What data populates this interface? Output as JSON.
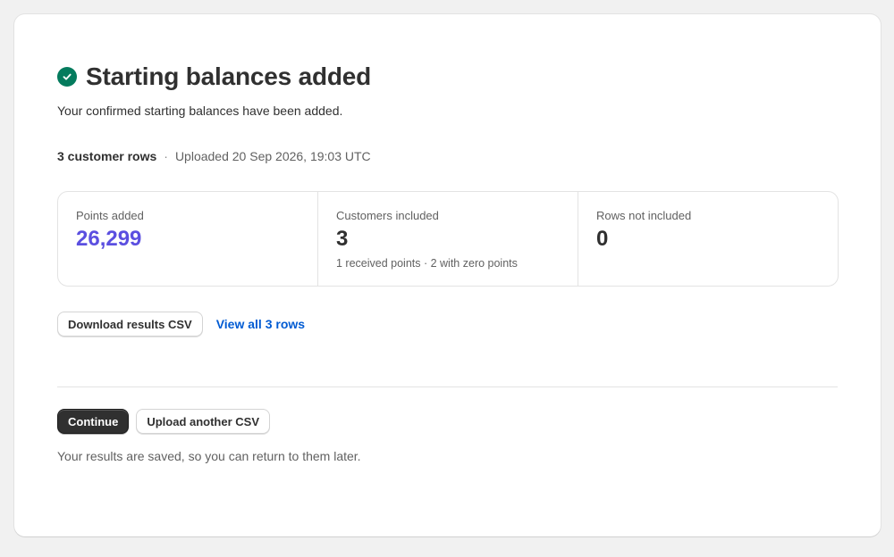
{
  "header": {
    "title": "Starting balances added",
    "subtitle": "Your confirmed starting balances have been added.",
    "icon": "check-circle-icon",
    "success_color": "#047b5d"
  },
  "meta": {
    "rows": "3 customer rows",
    "separator": "·",
    "uploaded": "Uploaded 20 Sep 2026, 19:03 UTC"
  },
  "stats": [
    {
      "label": "Points added",
      "value": "26,299",
      "sub": "",
      "accent": "#5b4fe0"
    },
    {
      "label": "Customers included",
      "value": "3",
      "sub": "1 received points · 2 with zero points"
    },
    {
      "label": "Rows not included",
      "value": "0",
      "sub": ""
    }
  ],
  "actions": {
    "download_label": "Download results CSV",
    "view_all_label": "View all 3 rows"
  },
  "footer": {
    "continue_label": "Continue",
    "upload_label": "Upload another CSV",
    "note": "Your results are saved, so you can return to them later."
  }
}
